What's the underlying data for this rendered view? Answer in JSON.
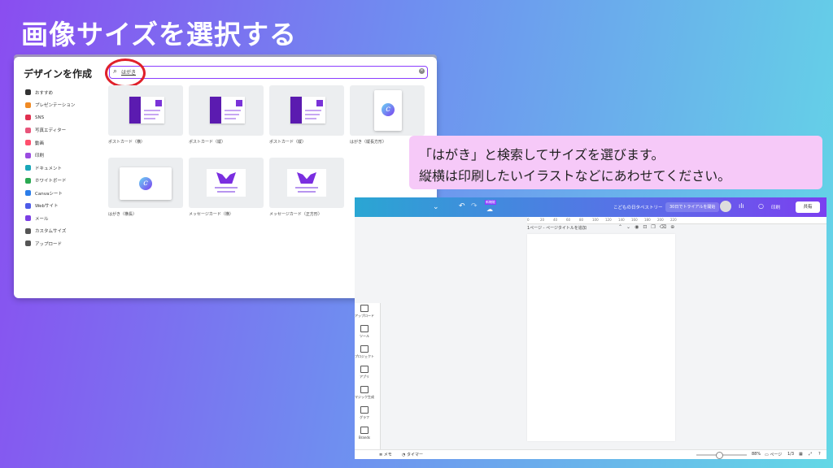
{
  "page_title": "画像サイズを選択する",
  "dialog": {
    "title": "デザインを作成",
    "search_query": "はがき",
    "sidebar": [
      {
        "label": "おすすめ",
        "color": "#333333"
      },
      {
        "label": "プレゼンテーション",
        "color": "#f08a24"
      },
      {
        "label": "SNS",
        "color": "#e0304f"
      },
      {
        "label": "写真エディター",
        "color": "#e8557a"
      },
      {
        "label": "動画",
        "color": "#ff4f6d"
      },
      {
        "label": "印刷",
        "color": "#9a4be0"
      },
      {
        "label": "ドキュメント",
        "color": "#19a6b8"
      },
      {
        "label": "ホワイトボード",
        "color": "#2aa952"
      },
      {
        "label": "Canvaシート",
        "color": "#2b7de9"
      },
      {
        "label": "Webサイト",
        "color": "#4d5be8"
      },
      {
        "label": "メール",
        "color": "#7b3fe4"
      },
      {
        "label": "カスタムサイズ",
        "color": "#555555"
      },
      {
        "label": "アップロード",
        "color": "#555555"
      }
    ],
    "cards": [
      {
        "label": "ポストカード（横）",
        "thumb": "postcard"
      },
      {
        "label": "ポストカード（縦）",
        "thumb": "postcard"
      },
      {
        "label": "ポストカード（縦）",
        "thumb": "postcard"
      },
      {
        "label": "はがき（縦長方形）",
        "thumb": "hagaki-tall"
      },
      {
        "label": "はがき（横長）",
        "thumb": "hagaki-wide"
      },
      {
        "label": "メッセージカード（横）",
        "thumb": "message"
      },
      {
        "label": "メッセージカード（正方形）",
        "thumb": "message"
      }
    ]
  },
  "callout": {
    "line1": "「はがき」と検索してサイズを選びます。",
    "line2": "縦横は印刷したいイラストなどにあわせてください。"
  },
  "editor": {
    "doc_title": "こどもの日タペストリー",
    "trial_label": "30日でトライアルを開始",
    "badge_label": "新機能",
    "print_label": "印刷",
    "share_label": "共有",
    "page_label": "1ページ - ページタイトルを追加",
    "ruler_ticks": [
      "0",
      "20",
      "40",
      "60",
      "80",
      "100",
      "120",
      "140",
      "160",
      "180",
      "200",
      "220"
    ],
    "left_tools": [
      "アップロード",
      "ツール",
      "プロジェクト",
      "アプリ",
      "マジック生成",
      "グラフ",
      "Brands"
    ],
    "bottom": {
      "notes": "メモ",
      "timer": "タイマー",
      "zoom": "88%",
      "pages": "ページ",
      "page_count": "1/3"
    }
  }
}
